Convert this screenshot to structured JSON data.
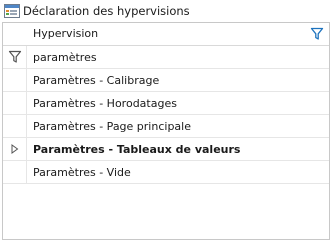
{
  "window": {
    "title": "Déclaration des hypervisions"
  },
  "grid": {
    "column_header": "Hypervision",
    "filter_value": "paramètres",
    "rows": [
      {
        "label": "Paramètres - Calibrage",
        "selected": false
      },
      {
        "label": "Paramètres - Horodatages",
        "selected": false
      },
      {
        "label": "Paramètres - Page principale",
        "selected": false
      },
      {
        "label": "Paramètres - Tableaux de valeurs",
        "selected": true
      },
      {
        "label": "Paramètres - Vide",
        "selected": false
      }
    ]
  },
  "icons": {
    "app": "grid-window-icon",
    "header_filter": "filter-icon",
    "row_filter": "filter-icon",
    "current_row": "row-pointer-icon"
  },
  "colors": {
    "filter_accent": "#1e73be",
    "grid_border": "#c8c8c8"
  }
}
